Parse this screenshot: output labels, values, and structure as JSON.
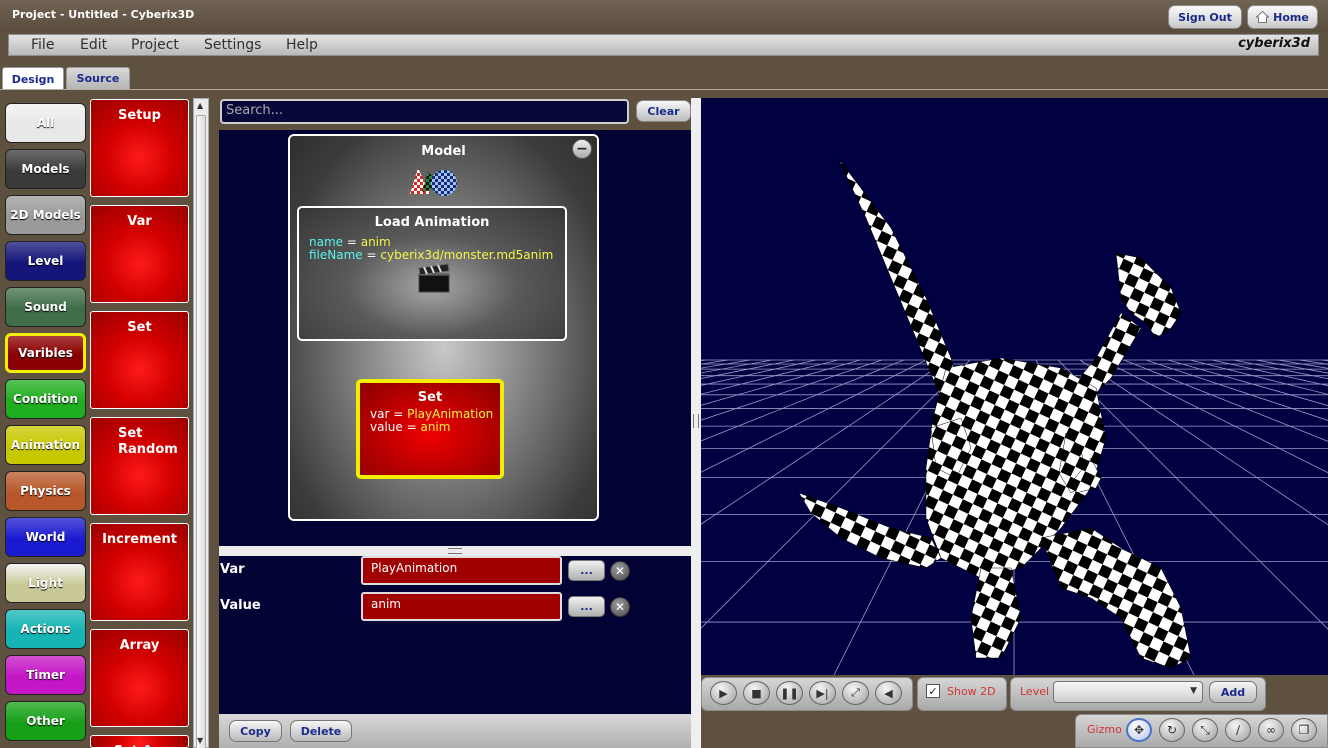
{
  "window": {
    "title": "Project - Untitled - Cyberix3D"
  },
  "header": {
    "sign_out": "Sign Out",
    "home": "Home",
    "brand": "cyberix3d"
  },
  "menu": [
    "File",
    "Edit",
    "Project",
    "Settings",
    "Help"
  ],
  "tabs": {
    "design": "Design",
    "source": "Source"
  },
  "categories": [
    {
      "label": "All",
      "color": "#e8e8e8"
    },
    {
      "label": "Models",
      "color": "#3a3a3a"
    },
    {
      "label": "2D Models",
      "color": "#9a9a9a"
    },
    {
      "label": "Level",
      "color": "#15157a"
    },
    {
      "label": "Sound",
      "color": "#3f6e48"
    },
    {
      "label": "Varibles",
      "color": "#8a0000"
    },
    {
      "label": "Condition",
      "color": "#1fae1f"
    },
    {
      "label": "Animation",
      "color": "#c8c800"
    },
    {
      "label": "Physics",
      "color": "#b8582a"
    },
    {
      "label": "World",
      "color": "#1a1ad0"
    },
    {
      "label": "Light",
      "color": "#c8c896"
    },
    {
      "label": "Actions",
      "color": "#16b4b4"
    },
    {
      "label": "Timer",
      "color": "#c416c4"
    },
    {
      "label": "Other",
      "color": "#16a016"
    }
  ],
  "tools": [
    "Setup",
    "Var",
    "Set",
    "Set Random",
    "Increment",
    "Array",
    "Set Arr"
  ],
  "search": {
    "placeholder": "Search...",
    "clear": "Clear"
  },
  "model_block": {
    "title": "Model",
    "load_animation": {
      "title": "Load Animation",
      "params": [
        {
          "key": "name",
          "value": "anim"
        },
        {
          "key": "fileName",
          "value": "cyberix3d/monster.md5anim"
        }
      ]
    },
    "set": {
      "title": "Set",
      "params": [
        {
          "key": "var",
          "value": "PlayAnimation"
        },
        {
          "key": "value",
          "value": "anim"
        }
      ]
    }
  },
  "properties": [
    {
      "label": "Var",
      "value": "PlayAnimation"
    },
    {
      "label": "Value",
      "value": "anim"
    }
  ],
  "buttons": {
    "dots": "...",
    "copy": "Copy",
    "delete": "Delete",
    "add": "Add"
  },
  "playback": {
    "show2d": "Show 2D",
    "level": "Level",
    "gizmo": "Gizmo",
    "show2d_checked": true
  }
}
